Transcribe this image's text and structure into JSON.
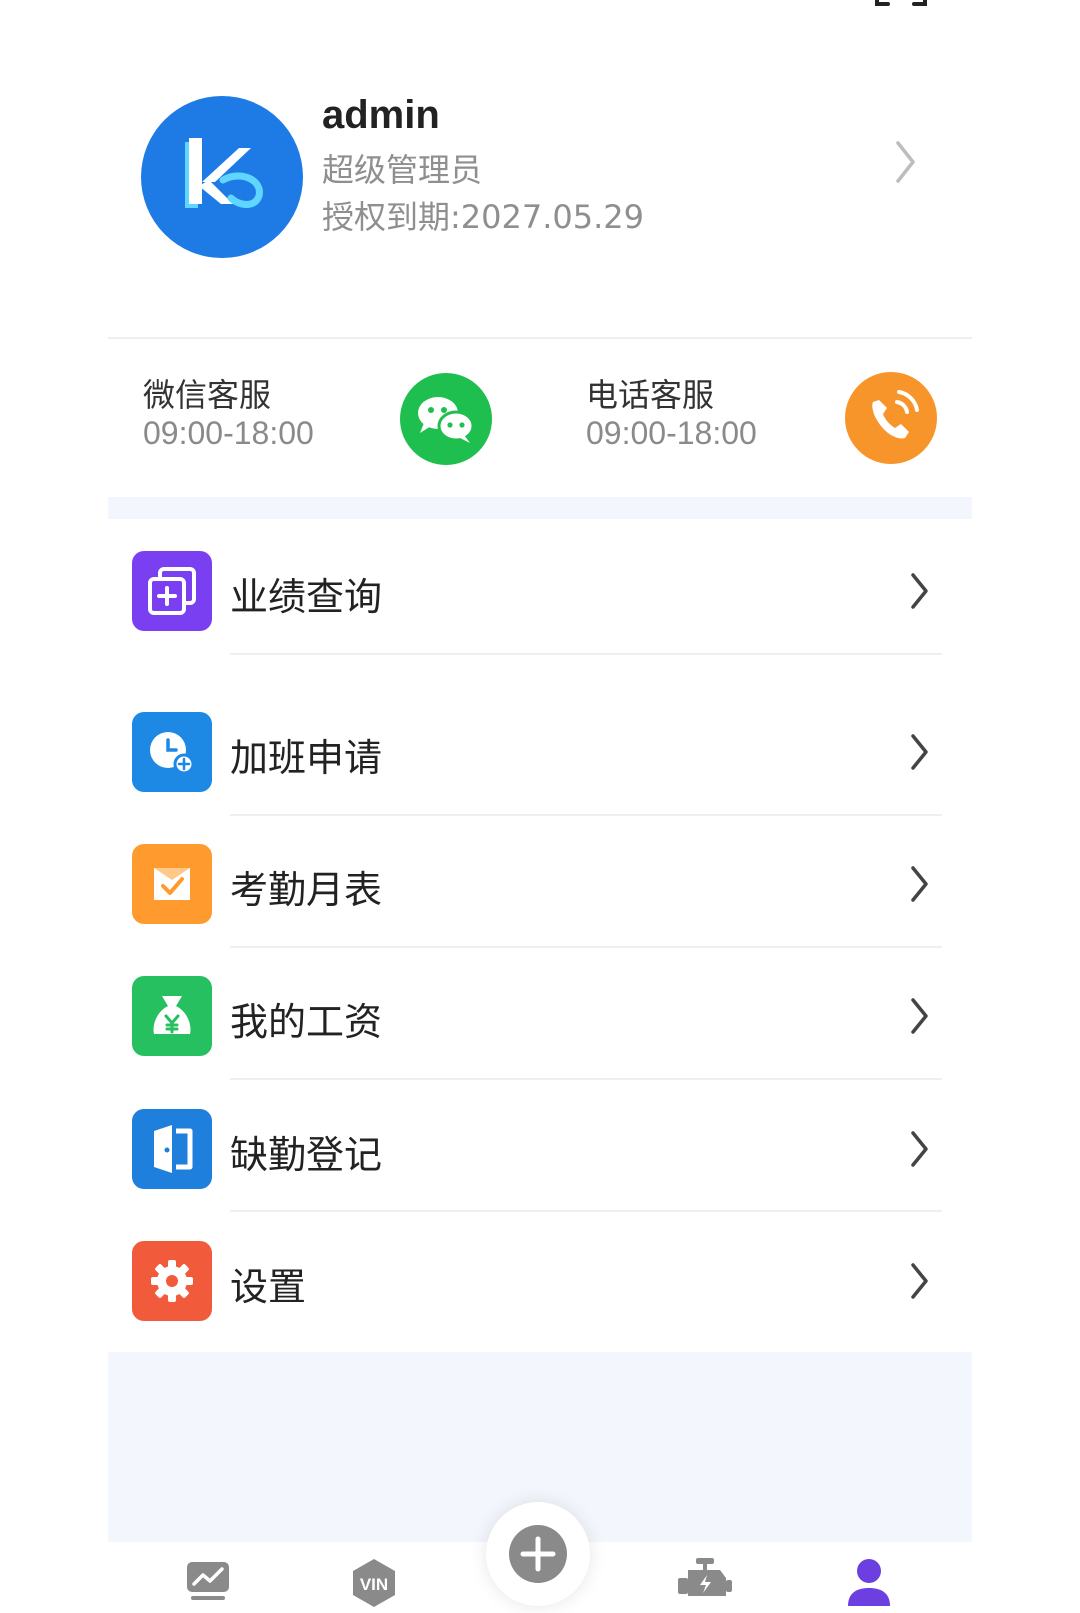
{
  "profile": {
    "username": "admin",
    "role": "超级管理员",
    "expiry": "授权到期:2027.05.29"
  },
  "service": {
    "wechat": {
      "title": "微信客服",
      "hours": "09:00-18:00",
      "icon": "wechat-icon"
    },
    "phone": {
      "title": "电话客服",
      "hours": "09:00-18:00",
      "icon": "phone-icon"
    }
  },
  "menu": {
    "items": [
      {
        "label": "业绩查询",
        "icon": "add-document-icon",
        "color": "#7B3FF2"
      },
      {
        "label": "加班申请",
        "icon": "clock-add-icon",
        "color": "#1E88E5"
      },
      {
        "label": "考勤月表",
        "icon": "attendance-check-icon",
        "color": "#FF9A2E"
      },
      {
        "label": "我的工资",
        "icon": "money-bag-icon",
        "color": "#27C060"
      },
      {
        "label": "缺勤登记",
        "icon": "door-icon",
        "color": "#1F7FDC"
      },
      {
        "label": "设置",
        "icon": "gear-icon",
        "color": "#F25A3C"
      }
    ]
  },
  "bottom_nav": {
    "items": [
      {
        "icon": "chart-icon"
      },
      {
        "icon": "vin-icon",
        "text": "VIN"
      },
      {
        "icon": "plus-icon"
      },
      {
        "icon": "engine-icon"
      },
      {
        "icon": "user-icon",
        "active": true,
        "color": "#6B3FE0"
      }
    ]
  },
  "colors": {
    "accent": "#1E7BE6",
    "divider": "#efefef",
    "band": "#f3f6fc"
  }
}
